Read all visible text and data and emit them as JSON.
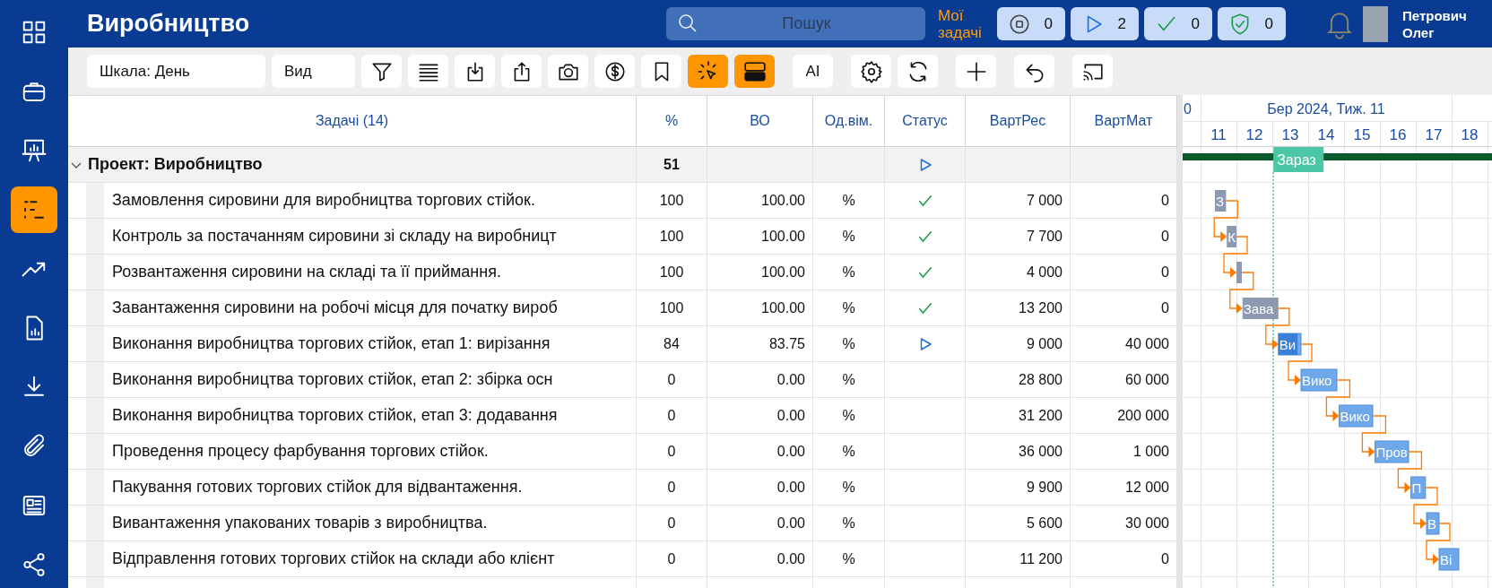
{
  "sidebar": {
    "items": [
      {
        "kind": "apps",
        "selected": false
      },
      {
        "kind": "briefcase",
        "selected": false
      },
      {
        "kind": "presentation",
        "selected": false
      },
      {
        "kind": "gantt",
        "selected": true
      },
      {
        "kind": "trend",
        "selected": false
      },
      {
        "kind": "report",
        "selected": false
      },
      {
        "kind": "download",
        "selected": false
      },
      {
        "kind": "paperclip",
        "selected": false
      },
      {
        "kind": "news",
        "selected": false
      },
      {
        "kind": "share",
        "selected": false
      }
    ]
  },
  "header": {
    "title": "Виробництво",
    "search": {
      "placeholder": "Пошук"
    },
    "my_tasks": "Мої задачі",
    "counters": [
      {
        "kind": "stopped",
        "count": "0"
      },
      {
        "kind": "running",
        "count": "2"
      },
      {
        "kind": "done",
        "count": "0"
      },
      {
        "kind": "approved",
        "count": "0"
      }
    ],
    "user": {
      "name": "Петрович Олег"
    }
  },
  "toolbar": {
    "scale": "Шкала: День",
    "view": "Вид",
    "groups": [
      [
        {
          "kind": "filter",
          "selected": false
        },
        {
          "kind": "lines",
          "selected": false
        },
        {
          "kind": "import",
          "selected": false
        },
        {
          "kind": "export",
          "selected": false
        },
        {
          "kind": "camera",
          "selected": false
        },
        {
          "kind": "dollar",
          "selected": false
        },
        {
          "kind": "bookmark",
          "selected": false
        },
        {
          "kind": "pointer",
          "selected": true
        },
        {
          "kind": "layout",
          "selected": true
        }
      ],
      [
        {
          "kind": "text",
          "label": "AI",
          "selected": false
        }
      ],
      [
        {
          "kind": "gear",
          "selected": false
        },
        {
          "kind": "refresh",
          "selected": false
        }
      ],
      [
        {
          "kind": "plus",
          "selected": false
        }
      ],
      [
        {
          "kind": "undo",
          "selected": false
        }
      ],
      [
        {
          "kind": "cast",
          "selected": false
        }
      ]
    ]
  },
  "table": {
    "columns": [
      "Задачі (14)",
      "%",
      "ВО",
      "Од.вім.",
      "Статус",
      "ВартРес",
      "ВартМат"
    ],
    "project": {
      "name": "Проект: Виробництво",
      "expanded": true,
      "percent": "51",
      "done": false,
      "running": true
    },
    "rows": [
      {
        "name": "Замовлення сировини для виробництва торгових стійок.",
        "percent": "100",
        "done_value": "100.00",
        "unit": "%",
        "done": true,
        "running": false,
        "res_cost": "7 000",
        "mat_cost": "0"
      },
      {
        "name": "Контроль за постачанням сировини зі складу на виробницт",
        "percent": "100",
        "done_value": "100.00",
        "unit": "%",
        "done": true,
        "running": false,
        "res_cost": "7 700",
        "mat_cost": "0"
      },
      {
        "name": "Розвантаження сировини на складі та її приймання.",
        "percent": "100",
        "done_value": "100.00",
        "unit": "%",
        "done": true,
        "running": false,
        "res_cost": "4 000",
        "mat_cost": "0"
      },
      {
        "name": "Завантаження сировини на робочі місця для початку вироб",
        "percent": "100",
        "done_value": "100.00",
        "unit": "%",
        "done": true,
        "running": false,
        "res_cost": "13 200",
        "mat_cost": "0"
      },
      {
        "name": "Виконання виробництва торгових стійок, етап 1: вирізання",
        "percent": "84",
        "done_value": "83.75",
        "unit": "%",
        "done": false,
        "running": true,
        "res_cost": "9 000",
        "mat_cost": "40 000"
      },
      {
        "name": "Виконання виробництва торгових стійок, етап 2: збірка осн",
        "percent": "0",
        "done_value": "0.00",
        "unit": "%",
        "done": false,
        "running": false,
        "res_cost": "28 800",
        "mat_cost": "60 000"
      },
      {
        "name": "Виконання виробництва торгових стійок, етап 3: додавання",
        "percent": "0",
        "done_value": "0.00",
        "unit": "%",
        "done": false,
        "running": false,
        "res_cost": "31 200",
        "mat_cost": "200 000"
      },
      {
        "name": "Проведення процесу фарбування торгових стійок.",
        "percent": "0",
        "done_value": "0.00",
        "unit": "%",
        "done": false,
        "running": false,
        "res_cost": "36 000",
        "mat_cost": "1 000"
      },
      {
        "name": "Пакування готових торгових стійок для відвантаження.",
        "percent": "0",
        "done_value": "0.00",
        "unit": "%",
        "done": false,
        "running": false,
        "res_cost": "9 900",
        "mat_cost": "12 000"
      },
      {
        "name": "Вивантаження упакованих товарів з виробництва.",
        "percent": "0",
        "done_value": "0.00",
        "unit": "%",
        "done": false,
        "running": false,
        "res_cost": "5 600",
        "mat_cost": "30 000"
      },
      {
        "name": "Відправлення готових торгових стійок на склади або клієнт",
        "percent": "0",
        "done_value": "0.00",
        "unit": "%",
        "done": false,
        "running": false,
        "res_cost": "11 200",
        "mat_cost": "0"
      }
    ]
  },
  "gantt": {
    "previous_week": "0",
    "week": "Бер 2024, Тиж. 11",
    "days": [
      "11",
      "12",
      "13",
      "14",
      "15",
      "16",
      "17",
      "18"
    ],
    "today": {
      "label": "Зараз"
    },
    "bars": [
      {
        "label": "З",
        "kind": "done",
        "linked": false
      },
      {
        "label": "К",
        "kind": "done",
        "linked": true
      },
      {
        "kind": "done",
        "linked": true
      },
      {
        "label": "Зава",
        "kind": "done",
        "linked": true
      },
      {
        "label": "Ви",
        "kind": "active",
        "level": 0.84,
        "linked": true
      },
      {
        "label": "Вико",
        "kind": "planned",
        "linked": true
      },
      {
        "label": "Вико",
        "kind": "planned",
        "linked": true
      },
      {
        "label": "Пров",
        "kind": "planned",
        "linked": true
      },
      {
        "label": "П",
        "kind": "planned",
        "linked": true
      },
      {
        "label": "В",
        "kind": "planned",
        "linked": true
      },
      {
        "label": "Ві",
        "kind": "planned",
        "linked": true
      }
    ]
  }
}
